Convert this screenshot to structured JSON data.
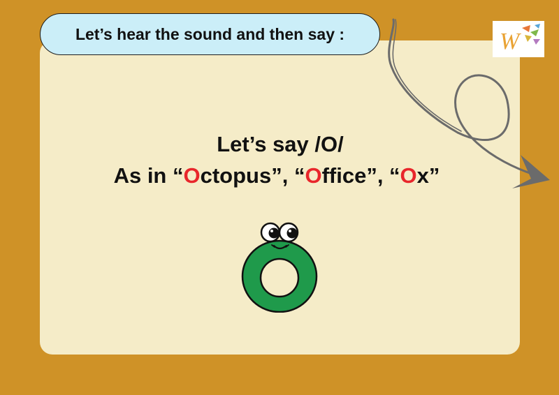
{
  "colors": {
    "background": "#cf9227",
    "card": "#f5ecc8",
    "pill": "#cbeef8",
    "highlight": "#e8262b",
    "letter_green": "#1f9a4b",
    "arrow_gray": "#6b6b6b"
  },
  "header": {
    "pill_text": "Let’s hear the sound and then say :"
  },
  "logo": {
    "icon": "w-leaves-logo-icon",
    "letter": "W"
  },
  "main": {
    "line1": "Let’s say /O/",
    "line2": {
      "prefix": "As in “",
      "w1_hl": "O",
      "w1_rest": "ctopus”, “",
      "w2_hl": "O",
      "w2_rest": "ffice”, “",
      "w3_hl": "O",
      "w3_rest": "x”"
    }
  },
  "decor": {
    "arrow_icon": "curly-arrow-icon",
    "mascot_icon": "letter-o-character-icon"
  }
}
